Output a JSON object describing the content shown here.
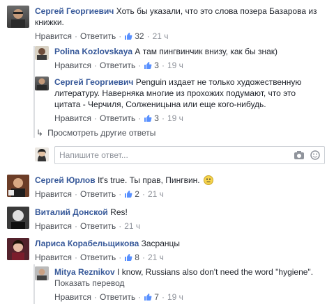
{
  "comments": [
    {
      "name": "Сергей Георгиевич",
      "text": "Хоть бы указали, что это слова позера Базарова из книжки.",
      "reply_label": "Нравится",
      "answer_label": "Ответить",
      "likes": "32",
      "time": "21 ч"
    },
    {
      "name": "Polina Kozlovskaya",
      "text": "А там пингвинчик внизу, как бы знак)",
      "reply_label": "Нравится",
      "answer_label": "Ответить",
      "likes": "3",
      "time": "19 ч"
    },
    {
      "name": "Сергей Георгиевич",
      "text": "Penguin издает не только художественную литературу. Наверняка многие из прохожих подумают, что это цитата - Черчиля, Солженицына или еще кого-нибудь.",
      "reply_label": "Нравится",
      "answer_label": "Ответить",
      "likes": "3",
      "time": "19 ч"
    },
    {
      "name": "Сергей Юрлов",
      "text": "It's true. Ты прав, Пингвин.",
      "reply_label": "Нравится",
      "answer_label": "Ответить",
      "likes": "2",
      "time": "21 ч"
    },
    {
      "name": "Виталий Донской",
      "text": "Res!",
      "reply_label": "Нравится",
      "answer_label": "Ответить",
      "time": "21 ч"
    },
    {
      "name": "Лариса Корабельщикова",
      "text": "Засранцы",
      "reply_label": "Нравится",
      "answer_label": "Ответить",
      "likes": "8",
      "time": "21 ч"
    },
    {
      "name": "Mitya Reznikov",
      "text": "I know, Russians also don't need the word \"hygiene\".",
      "translate": "Показать перевод",
      "reply_label": "Нравится",
      "answer_label": "Ответить",
      "likes": "7",
      "time": "19 ч"
    }
  ],
  "more_replies": "Просмотреть другие ответы",
  "reply_input": {
    "placeholder": "Напишите ответ..."
  },
  "colors": {
    "link": "#365899",
    "meta": "#90949c",
    "like_blue": "#5890ff"
  },
  "icons": [
    "thumbs-up-icon",
    "reply-arrow-icon",
    "camera-icon",
    "emoji-icon",
    "smiley-emoji-icon"
  ]
}
